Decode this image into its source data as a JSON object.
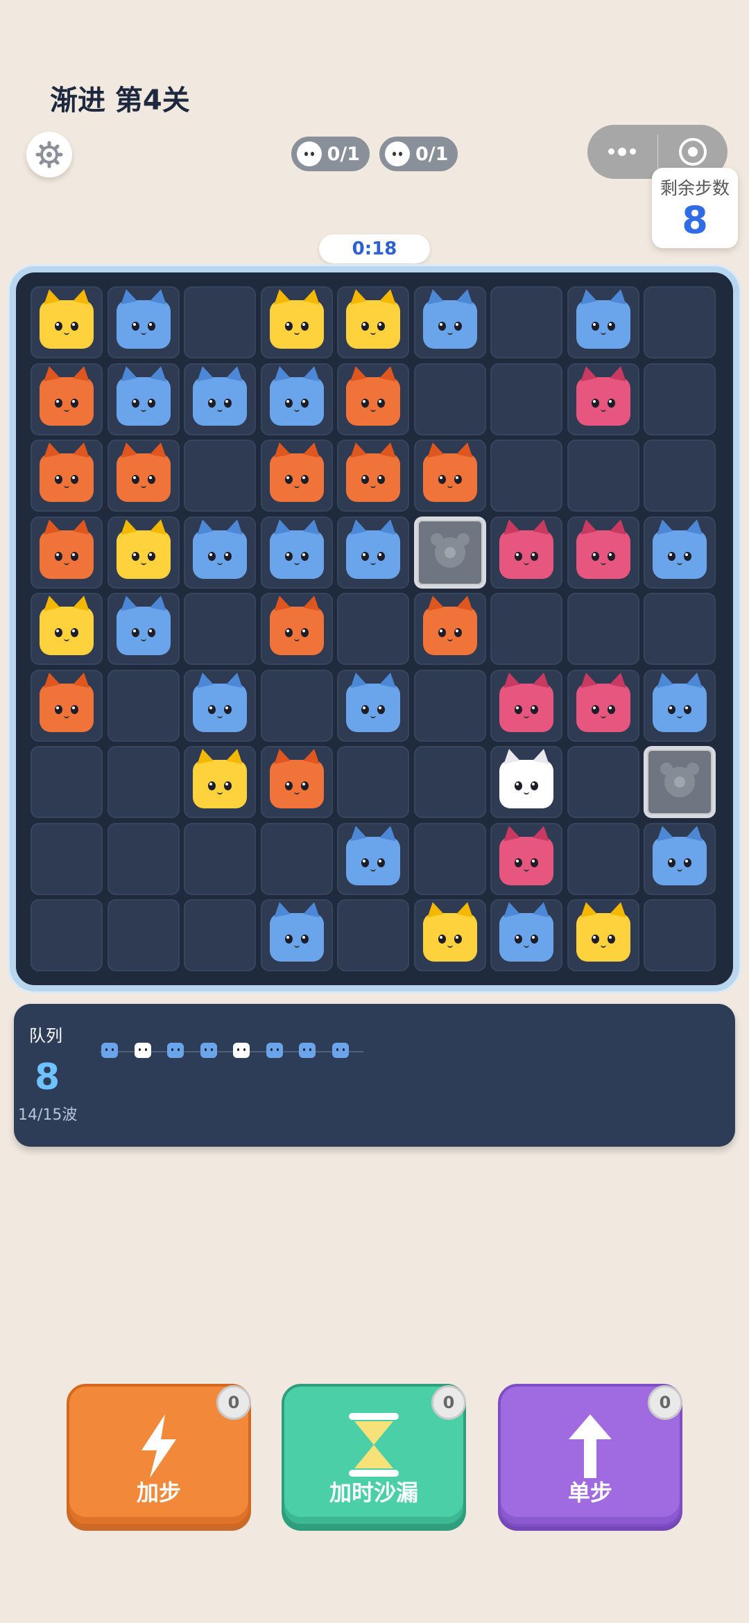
{
  "header": {
    "level_title": "渐进 第4关",
    "steps_label": "剩余步数",
    "steps_value": "8",
    "timer": "0:18"
  },
  "goals": [
    {
      "text": "0/1",
      "icon": "white-cat-icon"
    },
    {
      "text": "0/1",
      "icon": "white-cat-icon"
    }
  ],
  "colors": {
    "yellow": "#fdd23d",
    "blue": "#6aa5ec",
    "orange": "#f0743a",
    "pink": "#e6567f",
    "white": "#ffffff"
  },
  "board": {
    "grid": [
      [
        "Y",
        "B",
        ".",
        "Y",
        "Y",
        "B",
        ".",
        "B",
        "."
      ],
      [
        "O",
        "B",
        "B",
        "B",
        "O",
        ".",
        ".",
        "P",
        "."
      ],
      [
        "O",
        "O",
        ".",
        "O",
        "O",
        "O",
        ".",
        ".",
        "."
      ],
      [
        "O",
        "Y",
        "B",
        "B",
        "B",
        "S",
        "P",
        "P",
        "B"
      ],
      [
        "Y",
        "B",
        ".",
        "O",
        ".",
        "O",
        ".",
        ".",
        "."
      ],
      [
        "O",
        ".",
        "B",
        ".",
        "B",
        ".",
        "P",
        "P",
        "B"
      ],
      [
        ".",
        ".",
        "Y",
        "O",
        ".",
        ".",
        "W",
        ".",
        "S"
      ],
      [
        ".",
        ".",
        ".",
        ".",
        "B",
        ".",
        "P",
        ".",
        "B"
      ],
      [
        ".",
        ".",
        ".",
        "B",
        ".",
        "Y",
        "B",
        "Y",
        "."
      ]
    ]
  },
  "queue": {
    "label": "队列",
    "count": "8",
    "wave": "14/15波",
    "cats": [
      "B",
      "W",
      "B",
      "B",
      "W",
      "B",
      "B",
      "B"
    ]
  },
  "buttons": [
    {
      "label": "加步",
      "badge": "0",
      "icon": "lightning-icon"
    },
    {
      "label": "加时沙漏",
      "badge": "0",
      "icon": "hourglass-icon"
    },
    {
      "label": "单步",
      "badge": "0",
      "icon": "arrow-up-icon"
    }
  ]
}
